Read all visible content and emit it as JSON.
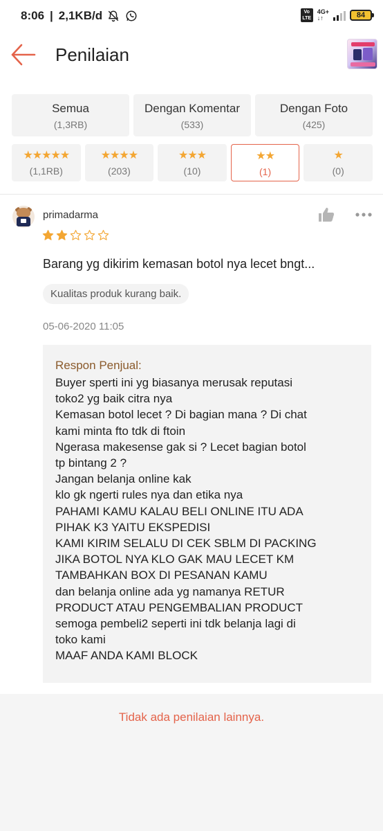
{
  "status_bar": {
    "time": "8:06",
    "speed": "2,1KB/d",
    "volte": "Vo LTE",
    "network": "4G+",
    "battery": "84"
  },
  "app_bar": {
    "title": "Penilaian"
  },
  "filters": {
    "row1": [
      {
        "label": "Semua",
        "count": "(1,3RB)"
      },
      {
        "label": "Dengan Komentar",
        "count": "(533)"
      },
      {
        "label": "Dengan Foto",
        "count": "(425)"
      }
    ],
    "row2": [
      {
        "stars": "★★★★★",
        "count": "(1,1RB)"
      },
      {
        "stars": "★★★★",
        "count": "(203)"
      },
      {
        "stars": "★★★",
        "count": "(10)"
      },
      {
        "stars": "★★",
        "count": "(1)"
      },
      {
        "stars": "★",
        "count": "(0)"
      }
    ],
    "selected_index": 3
  },
  "review": {
    "username": "primadarma",
    "rating": 2,
    "rating_max": 5,
    "text": "Barang yg dikirim kemasan botol nya lecet bngt...",
    "tag": "Kualitas produk kurang baik.",
    "date": "05-06-2020 11:05",
    "seller_response": {
      "title": "Respon Penjual:",
      "lines": [
        "Buyer sperti ini yg biasanya merusak reputasi",
        "toko2 yg baik citra nya",
        "Kemasan botol lecet ? Di bagian mana ? Di chat",
        "kami minta fto tdk di ftoin",
        "Ngerasa makesense gak si ? Lecet bagian botol",
        "tp bintang 2 ?",
        "Jangan belanja online kak",
        "klo gk ngerti rules nya dan etika nya",
        "PAHAMI KAMU KALAU BELI ONLINE ITU ADA",
        "PIHAK K3 YAITU EKSPEDISI",
        "KAMI KIRIM SELALU DI CEK SBLM DI PACKING",
        "JIKA BOTOL NYA KLO GAK MAU LECET KM",
        "TAMBAHKAN BOX DI PESANAN KAMU",
        "dan belanja online ada yg namanya RETUR",
        "PRODUCT ATAU PENGEMBALIAN PRODUCT",
        "semoga pembeli2 seperti ini tdk belanja lagi di",
        "toko kami",
        "MAAF ANDA KAMI BLOCK"
      ]
    }
  },
  "footer": {
    "text": "Tidak ada penilaian lainnya."
  },
  "colors": {
    "accent": "#e4634a",
    "star": "#f3a633",
    "seller_title": "#8a5a2b"
  }
}
